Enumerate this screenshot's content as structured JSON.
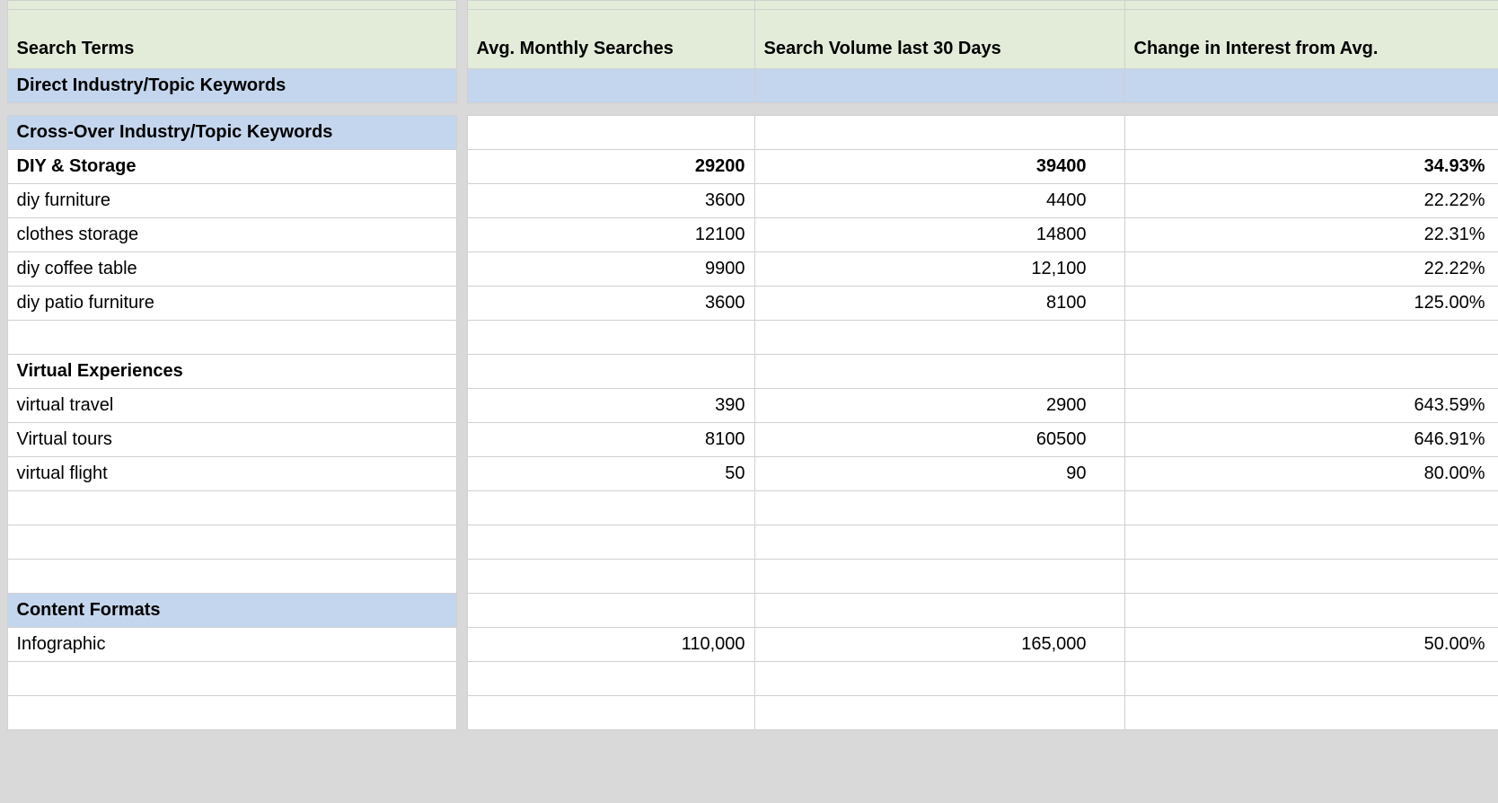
{
  "columns": {
    "c1": "Search Terms",
    "c3": "Avg. Monthly Searches",
    "c4": "Search Volume last 30 Days",
    "c5": "Change in Interest from Avg."
  },
  "sections": {
    "direct": {
      "label": "Direct Industry/Topic Keywords"
    },
    "crossover": {
      "label": "Cross-Over Industry/Topic Keywords"
    },
    "content": {
      "label": "Content Formats"
    }
  },
  "groups": {
    "diy": {
      "label": "DIY & Storage",
      "totals": {
        "avg": "29200",
        "vol": "39400",
        "chg": "34.93%"
      },
      "rows": [
        {
          "term": "diy furniture",
          "avg": "3600",
          "vol": "4400",
          "chg": "22.22%"
        },
        {
          "term": "clothes storage",
          "avg": "12100",
          "vol": "14800",
          "chg": "22.31%"
        },
        {
          "term": "diy coffee table",
          "avg": "9900",
          "vol": "12,100",
          "chg": "22.22%"
        },
        {
          "term": "diy patio furniture",
          "avg": "3600",
          "vol": "8100",
          "chg": "125.00%"
        }
      ]
    },
    "virtual": {
      "label": "Virtual Experiences",
      "rows": [
        {
          "term": "virtual travel",
          "avg": "390",
          "vol": "2900",
          "chg": "643.59%"
        },
        {
          "term": "Virtual tours",
          "avg": "8100",
          "vol": "60500",
          "chg": "646.91%"
        },
        {
          "term": "virtual flight",
          "avg": "50",
          "vol": "90",
          "chg": "80.00%"
        }
      ]
    },
    "contentRows": [
      {
        "term": "Infographic",
        "avg": "110,000",
        "vol": "165,000",
        "chg": "50.00%"
      }
    ]
  }
}
